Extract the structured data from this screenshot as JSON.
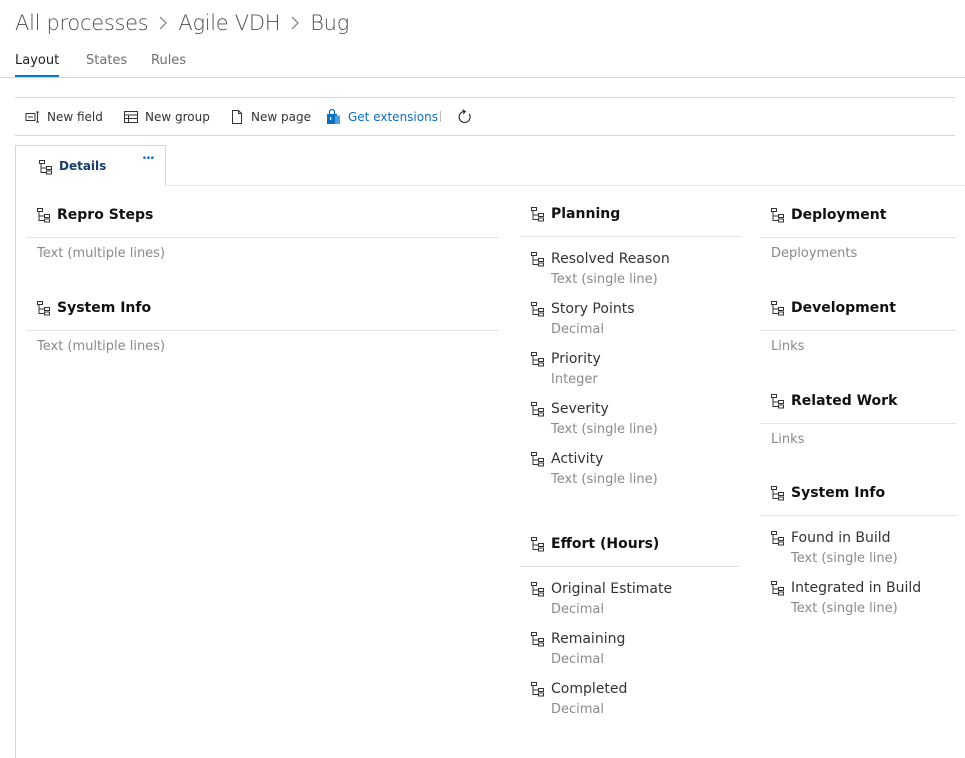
{
  "breadcrumb": {
    "items": [
      "All processes",
      "Agile VDH",
      "Bug"
    ]
  },
  "tabs": [
    {
      "label": "Layout",
      "active": true
    },
    {
      "label": "States",
      "active": false
    },
    {
      "label": "Rules",
      "active": false
    }
  ],
  "toolbar": {
    "new_field": "New field",
    "new_group": "New group",
    "new_page": "New page",
    "get_extensions": "Get extensions"
  },
  "page_tab": {
    "label": "Details",
    "more": "..."
  },
  "colors": {
    "accent": "#0078d4",
    "link": "#106ebe"
  },
  "groups": {
    "repro_steps": {
      "title": "Repro Steps",
      "subtitle": "Text (multiple lines)"
    },
    "system_info_left": {
      "title": "System Info",
      "subtitle": "Text (multiple lines)"
    },
    "planning": {
      "title": "Planning",
      "fields": [
        {
          "name": "Resolved Reason",
          "type": "Text (single line)"
        },
        {
          "name": "Story Points",
          "type": "Decimal"
        },
        {
          "name": "Priority",
          "type": "Integer"
        },
        {
          "name": "Severity",
          "type": "Text (single line)"
        },
        {
          "name": "Activity",
          "type": "Text (single line)"
        }
      ]
    },
    "effort": {
      "title": "Effort (Hours)",
      "fields": [
        {
          "name": "Original Estimate",
          "type": "Decimal"
        },
        {
          "name": "Remaining",
          "type": "Decimal"
        },
        {
          "name": "Completed",
          "type": "Decimal"
        }
      ]
    },
    "deployment": {
      "title": "Deployment",
      "subtitle": "Deployments"
    },
    "development": {
      "title": "Development",
      "subtitle": "Links"
    },
    "related_work": {
      "title": "Related Work",
      "subtitle": "Links"
    },
    "system_info_right": {
      "title": "System Info",
      "fields": [
        {
          "name": "Found in Build",
          "type": "Text (single line)"
        },
        {
          "name": "Integrated in Build",
          "type": "Text (single line)"
        }
      ]
    }
  }
}
